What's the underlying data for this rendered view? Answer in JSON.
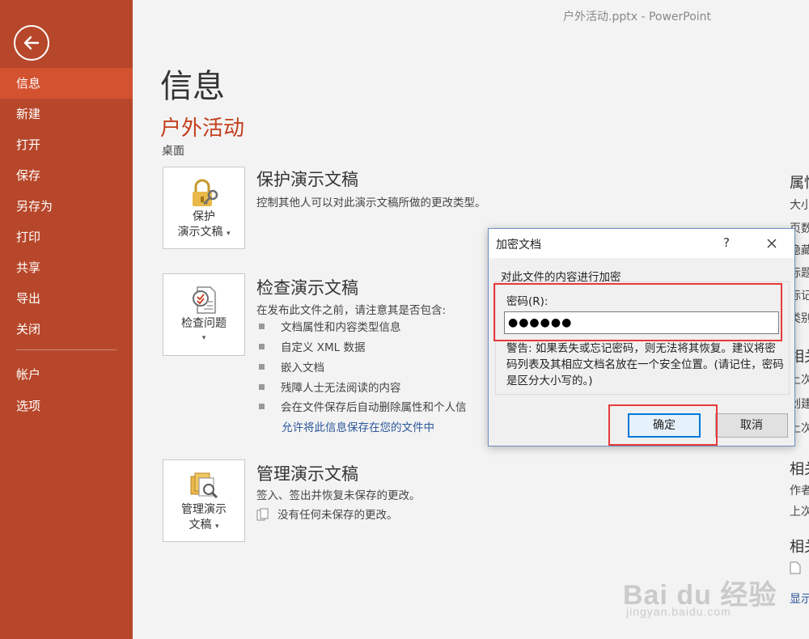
{
  "window_title": "户外活动.pptx - PowerPoint",
  "sidebar": {
    "back_icon": "back-arrow-icon",
    "items": [
      {
        "label": "信息"
      },
      {
        "label": "新建"
      },
      {
        "label": "打开"
      },
      {
        "label": "保存"
      },
      {
        "label": "另存为"
      },
      {
        "label": "打印"
      },
      {
        "label": "共享"
      },
      {
        "label": "导出"
      },
      {
        "label": "关闭"
      },
      {
        "label": "帐户"
      },
      {
        "label": "选项"
      }
    ],
    "active_index": 0,
    "colors": {
      "background": "#b7472a",
      "active": "#d35230"
    }
  },
  "main": {
    "page_title": "信息",
    "doc_title": "户外活动",
    "doc_location": "桌面",
    "protect": {
      "tile_line1": "保护",
      "tile_line2": "演示文稿",
      "title": "保护演示文稿",
      "desc": "控制其他人可以对此演示文稿所做的更改类型。",
      "icon": "lock-key-icon"
    },
    "inspect": {
      "tile_label": "检查问题",
      "title": "检查演示文稿",
      "desc": "在发布此文件之前，请注意其是否包含:",
      "bullets": [
        "文档属性和内容类型信息",
        "自定义 XML 数据",
        "嵌入文档",
        "残障人士无法阅读的内容",
        "会在文件保存后自动删除属性和个人信"
      ],
      "link": "允许将此信息保存在您的文件中",
      "icon": "inspect-document-icon"
    },
    "manage": {
      "tile_line1": "管理演示",
      "tile_line2": "文稿",
      "title": "管理演示文稿",
      "desc": "签入、签出并恢复未保存的更改。",
      "note": "没有任何未保存的更改。",
      "icon": "manage-versions-icon"
    }
  },
  "right_column": {
    "properties_heading": "属性",
    "property_rows": [
      "大小",
      "页数",
      "隐藏",
      "标题",
      "标记",
      "类别"
    ],
    "related_dates_heading": "相关",
    "date_rows": [
      "上次",
      "创建",
      "上次"
    ],
    "related_people_heading": "相关",
    "people_rows": [
      "作者",
      "上次"
    ],
    "related_docs_heading": "相关",
    "show_all_link": "显示"
  },
  "dialog": {
    "title": "加密文档",
    "help": "?",
    "caption": "对此文件的内容进行加密",
    "password_label": "密码(R):",
    "password_value": "●●●●●●",
    "warning": "警告: 如果丢失或忘记密码，则无法将其恢复。建议将密码列表及其相应文档名放在一个安全位置。(请记住，密码是区分大小写的。)",
    "ok_label": "确定",
    "cancel_label": "取消"
  },
  "watermark": {
    "brand": "Bai du 经验",
    "url": "jingyan.baidu.com"
  }
}
